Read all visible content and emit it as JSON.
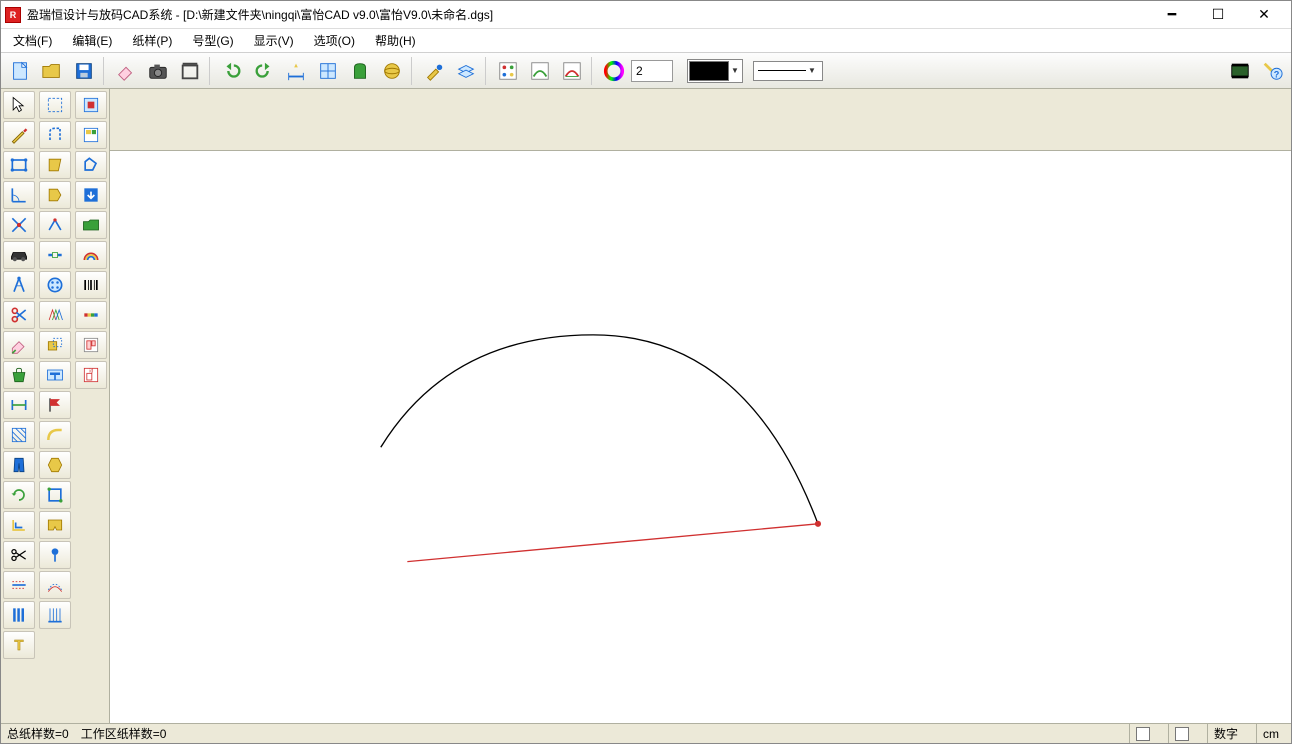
{
  "title": "盈瑞恒设计与放码CAD系统 - [D:\\新建文件夹\\ningqi\\富怡CAD v9.0\\富怡V9.0\\未命名.dgs]",
  "menus": [
    "文档(F)",
    "编辑(E)",
    "纸样(P)",
    "号型(G)",
    "显示(V)",
    "选项(O)",
    "帮助(H)"
  ],
  "toolbar": {
    "line_width_value": "2"
  },
  "status": {
    "total_patterns": "总纸样数=0",
    "work_patterns": "工作区纸样数=0",
    "num_label": "数字",
    "unit": "cm"
  },
  "colors": {
    "btn_blue": "#1e6fd8",
    "btn_yellow": "#e8c848",
    "btn_green": "#3aa03a",
    "btn_orange": "#e67e22",
    "btn_red": "#d03030",
    "btn_teal": "#2aa0a0"
  }
}
